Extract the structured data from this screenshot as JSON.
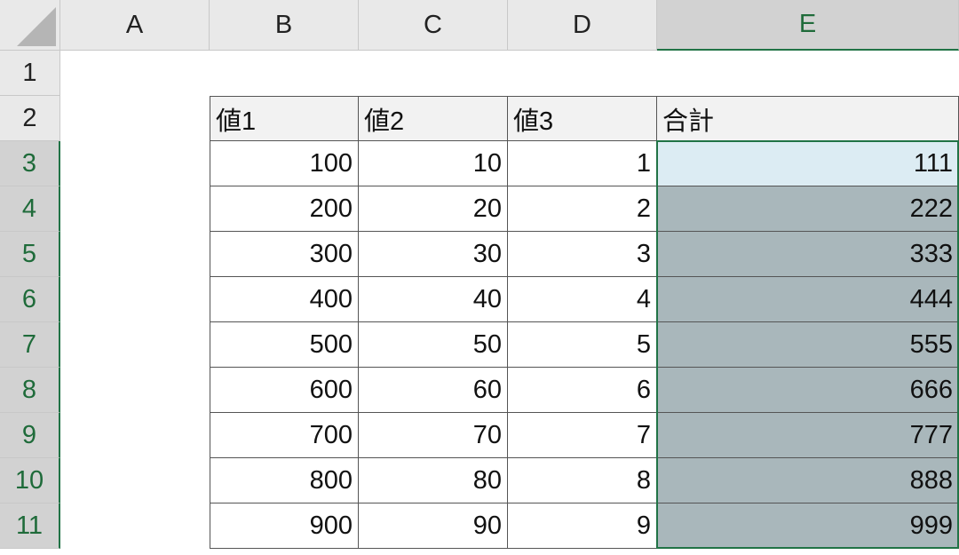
{
  "columns": [
    "A",
    "B",
    "C",
    "D",
    "E"
  ],
  "rows": [
    "1",
    "2",
    "3",
    "4",
    "5",
    "6",
    "7",
    "8",
    "9",
    "10",
    "11"
  ],
  "selected_column": "E",
  "selected_rows": [
    "3",
    "4",
    "5",
    "6",
    "7",
    "8",
    "9",
    "10",
    "11"
  ],
  "table": {
    "headers": [
      "値1",
      "値2",
      "値3",
      "合計"
    ],
    "rows": [
      [
        "100",
        "10",
        "1",
        "111"
      ],
      [
        "200",
        "20",
        "2",
        "222"
      ],
      [
        "300",
        "30",
        "3",
        "333"
      ],
      [
        "400",
        "40",
        "4",
        "444"
      ],
      [
        "500",
        "50",
        "5",
        "555"
      ],
      [
        "600",
        "60",
        "6",
        "666"
      ],
      [
        "700",
        "70",
        "7",
        "777"
      ],
      [
        "800",
        "80",
        "8",
        "888"
      ],
      [
        "900",
        "90",
        "9",
        "999"
      ]
    ]
  },
  "colors": {
    "selection_border": "#217346",
    "selection_fill": "#a9b7bb",
    "active_cell_fill": "#dcecf3",
    "selected_header_text": "#1f6b3a"
  }
}
